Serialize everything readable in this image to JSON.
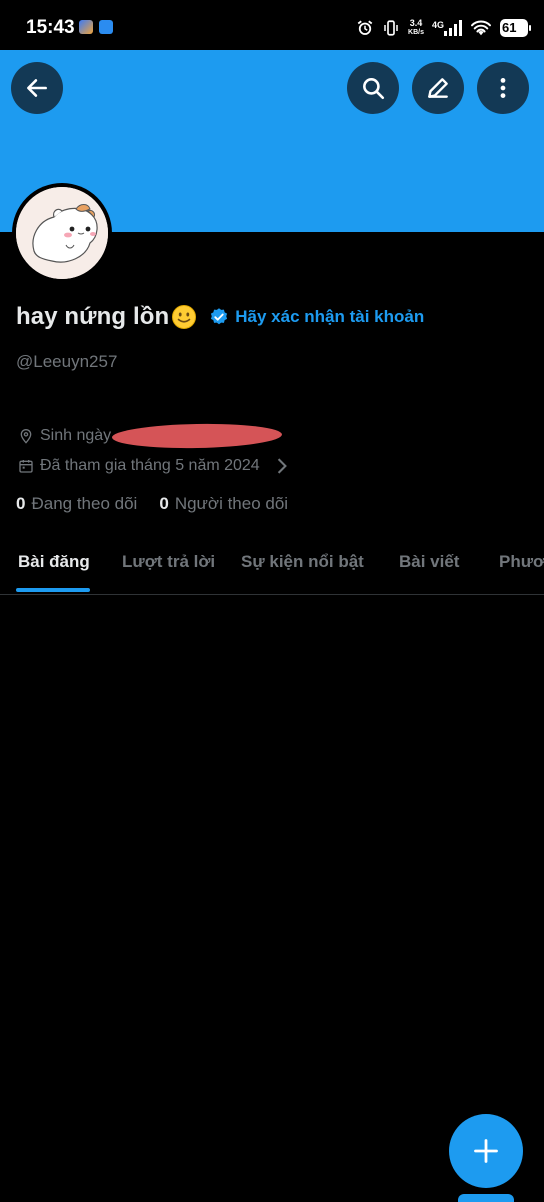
{
  "status_bar": {
    "time": "15:43",
    "speed_value": "3.4",
    "speed_unit": "KB/s",
    "network": "4G",
    "battery": "61"
  },
  "colors": {
    "accent": "#1d9bf0",
    "background": "#000000",
    "secondary_text": "#71767b",
    "redaction": "#e0585c"
  },
  "profile": {
    "display_name": "hay nứng lồn",
    "verify_link": "Hãy xác nhận tài khoản",
    "handle": "@Leeuyn257",
    "birthday_label": "Sinh ngày",
    "joined": "Đã tham gia tháng 5 năm 2024",
    "following_count": "0",
    "following_label": "Đang theo dõi",
    "followers_count": "0",
    "followers_label": "Người theo dõi"
  },
  "tabs": [
    {
      "label": "Bài đăng",
      "active": true
    },
    {
      "label": "Lượt trả lời",
      "active": false
    },
    {
      "label": "Sự kiện nổi bật",
      "active": false
    },
    {
      "label": "Bài viết",
      "active": false
    },
    {
      "label": "Phươ",
      "active": false
    }
  ],
  "icons": {
    "back": "arrow-left-icon",
    "search": "search-icon",
    "edit": "edit-pencil-icon",
    "more": "more-vertical-icon",
    "location": "location-pin-icon",
    "calendar": "calendar-icon",
    "verified": "verified-badge-icon",
    "compose": "plus-icon"
  }
}
